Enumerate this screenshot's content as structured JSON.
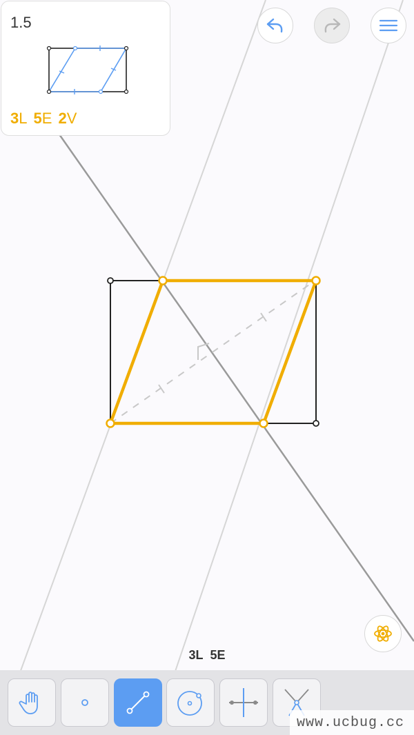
{
  "level": {
    "number": "1.5",
    "score": {
      "lines_value": "3",
      "lines_unit": "L",
      "euclid_value": "5",
      "euclid_unit": "E",
      "variant_value": "2",
      "variant_unit": "V"
    }
  },
  "counter": {
    "lines": "3L",
    "euclid": "5E"
  },
  "top_buttons": [
    {
      "name": "undo-button",
      "icon": "undo-arrow-icon",
      "enabled": true
    },
    {
      "name": "redo-button",
      "icon": "redo-arrow-icon",
      "enabled": false
    },
    {
      "name": "menu-button",
      "icon": "hamburger-menu-icon",
      "enabled": true
    }
  ],
  "hint_button": {
    "icon": "atom-icon"
  },
  "toolbar": {
    "tools": [
      {
        "name": "move-tool",
        "icon": "hand-icon",
        "active": false
      },
      {
        "name": "point-tool",
        "icon": "point-icon",
        "active": false
      },
      {
        "name": "line-tool",
        "icon": "line-segment-icon",
        "active": true
      },
      {
        "name": "circle-tool",
        "icon": "circle-compass-icon",
        "active": false
      },
      {
        "name": "perpendicular-bisector-tool",
        "icon": "perpendicular-bisector-icon",
        "active": false
      },
      {
        "name": "angle-bisector-tool",
        "icon": "angle-bisector-icon",
        "active": false
      }
    ]
  },
  "watermark": "www.ucbug.cc",
  "colors": {
    "highlight": "#f0ad00",
    "accent_blue": "#5c9df2",
    "construction_line": "#d6d6d6",
    "bisector_line": "#9a9a9a",
    "rectangle": "#222222",
    "guide_dashed": "#c8c8c8"
  }
}
